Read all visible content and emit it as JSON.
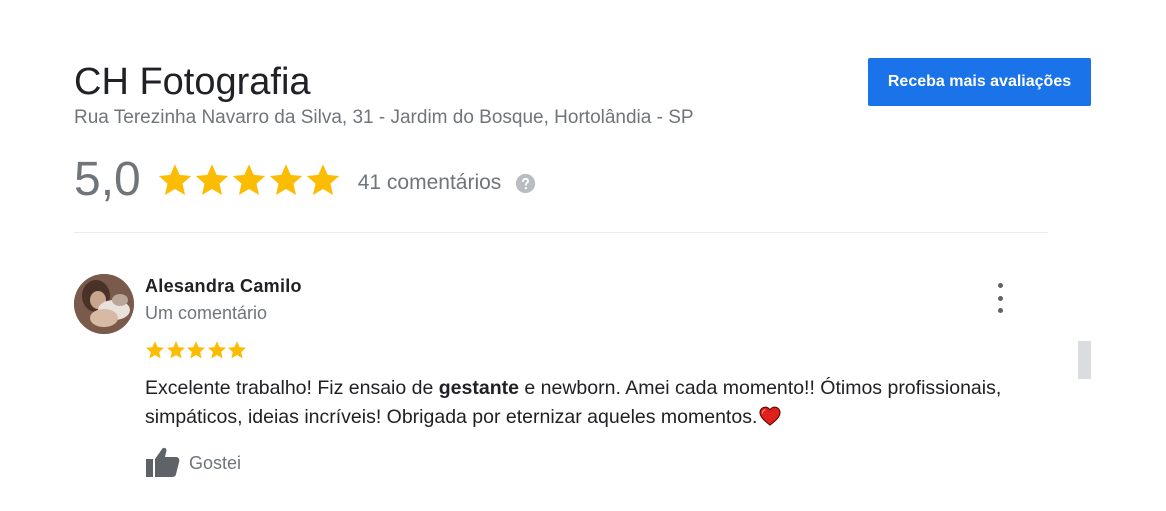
{
  "business": {
    "name": "CH Fotografia",
    "address": "Rua Terezinha Navarro da Silva, 31 - Jardim do Bosque, Hortolândia - SP"
  },
  "cta": {
    "label": "Receba mais avaliações"
  },
  "rating": {
    "value": "5,0",
    "stars": 5,
    "max_stars": 5,
    "count_label": "41 comentários",
    "help_icon": "help-circle-icon"
  },
  "review": {
    "author": "Alesandra Camilo",
    "meta": "Um comentário",
    "stars": 5,
    "text_before": "Excelente trabalho! Fiz ensaio de ",
    "text_bold": "gestante",
    "text_after": " e newborn. Amei cada momento!! Ótimos profissionais, simpáticos, ideias incríveis! Obrigada por eternizar aqueles momentos.",
    "emoji_icon": "red-heart-icon",
    "like_label": "Gostei",
    "like_icon": "thumbs-up-icon",
    "more_icon": "more-vert-icon"
  },
  "colors": {
    "accent_blue": "#1a73e8",
    "star_yellow": "#fbbc04",
    "muted_text": "#70757a",
    "heart_red": "#e0201a"
  }
}
